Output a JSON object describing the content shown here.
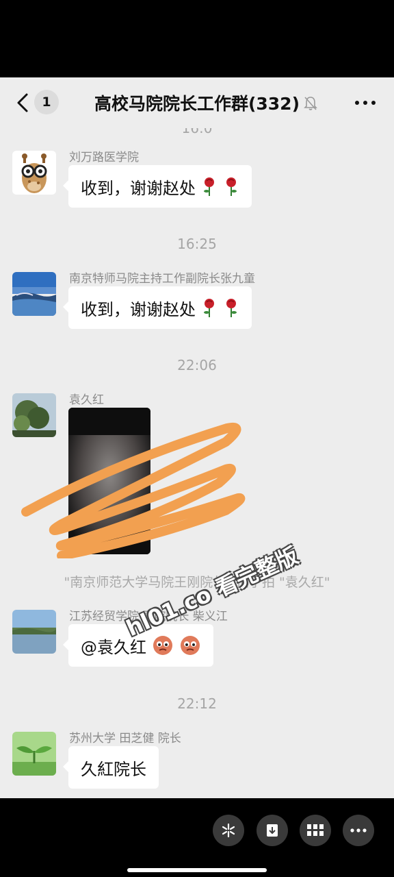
{
  "header": {
    "back_icon": "chevron-left-icon",
    "unread_count": "1",
    "title": "高校马院院长工作群(332)",
    "mute_icon": "bell-muted-icon",
    "more_icon": "more-horizontal-icon"
  },
  "messages": [
    {
      "sender": "刘万路医学院",
      "text": "收到，谢谢赵处",
      "emoji": "rose-emoji x2"
    },
    {
      "timestamp": "16:25"
    },
    {
      "sender": "南京特师马院主持工作副院长张九童",
      "text": "收到，谢谢赵处",
      "emoji": "rose-emoji x2"
    },
    {
      "timestamp": "22:06"
    },
    {
      "sender": "袁久红",
      "type": "video",
      "note": "video-thumbnail (redacted with orange scribble)"
    },
    {
      "system": "\"南京师范大学马院王刚院长\" 拍了拍 \"袁久红\""
    },
    {
      "sender": "江苏经贸学院 马院院长  柴义江",
      "text": "@袁久红",
      "emoji": "face-emoji x2"
    },
    {
      "timestamp": "22:12"
    },
    {
      "sender": "苏州大学 田芝健 院长",
      "text": "久紅院长"
    }
  ],
  "watermark": "hl01.co 看完整版",
  "bottom_bar": {
    "buttons": [
      "sparkle-icon",
      "download-icon",
      "grid-icon",
      "more-horizontal-icon"
    ]
  },
  "colors": {
    "chat_background": "#ededed",
    "bubble": "#ffffff",
    "scribble": "#f2a050"
  }
}
